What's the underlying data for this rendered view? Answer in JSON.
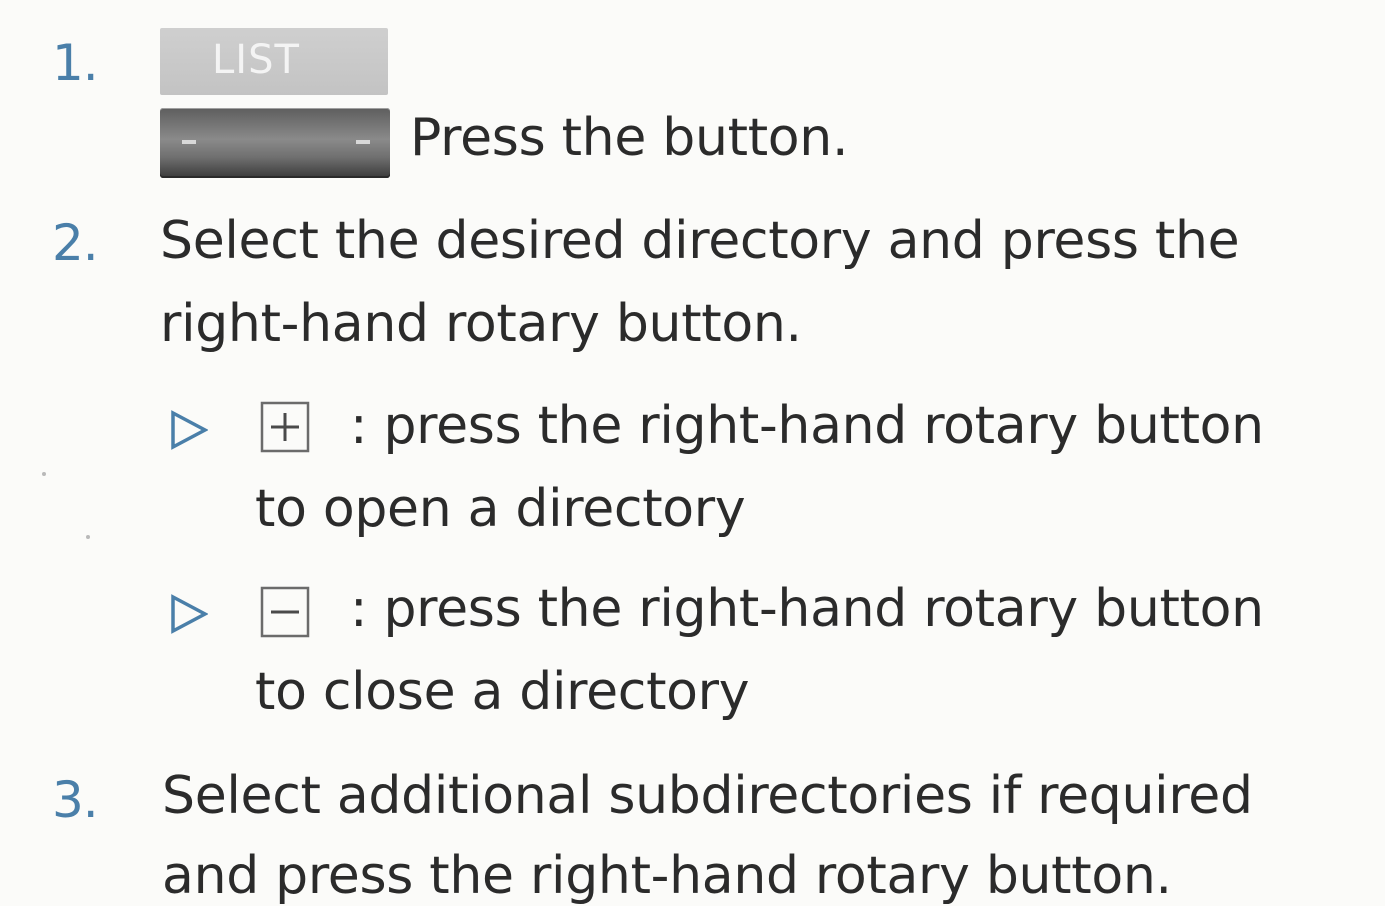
{
  "steps": [
    {
      "number": "1.",
      "key_label": "LIST",
      "text": "Press the button."
    },
    {
      "number": "2.",
      "line1": "Select the desired directory and press the",
      "line2": "right-hand rotary button.",
      "bullets": [
        {
          "icon": "plus-box-icon",
          "line1": ": press the right-hand rotary button",
          "line2": "to open a directory"
        },
        {
          "icon": "minus-box-icon",
          "line1": ": press the right-hand rotary button",
          "line2": "to close a directory"
        }
      ]
    },
    {
      "number": "3.",
      "line1": "Select additional subdirectories if required",
      "line2": "and press the right-hand rotary button."
    }
  ],
  "colors": {
    "accent": "#4a7fa9",
    "text": "#2b2b2b",
    "background": "#fbfbf9"
  }
}
